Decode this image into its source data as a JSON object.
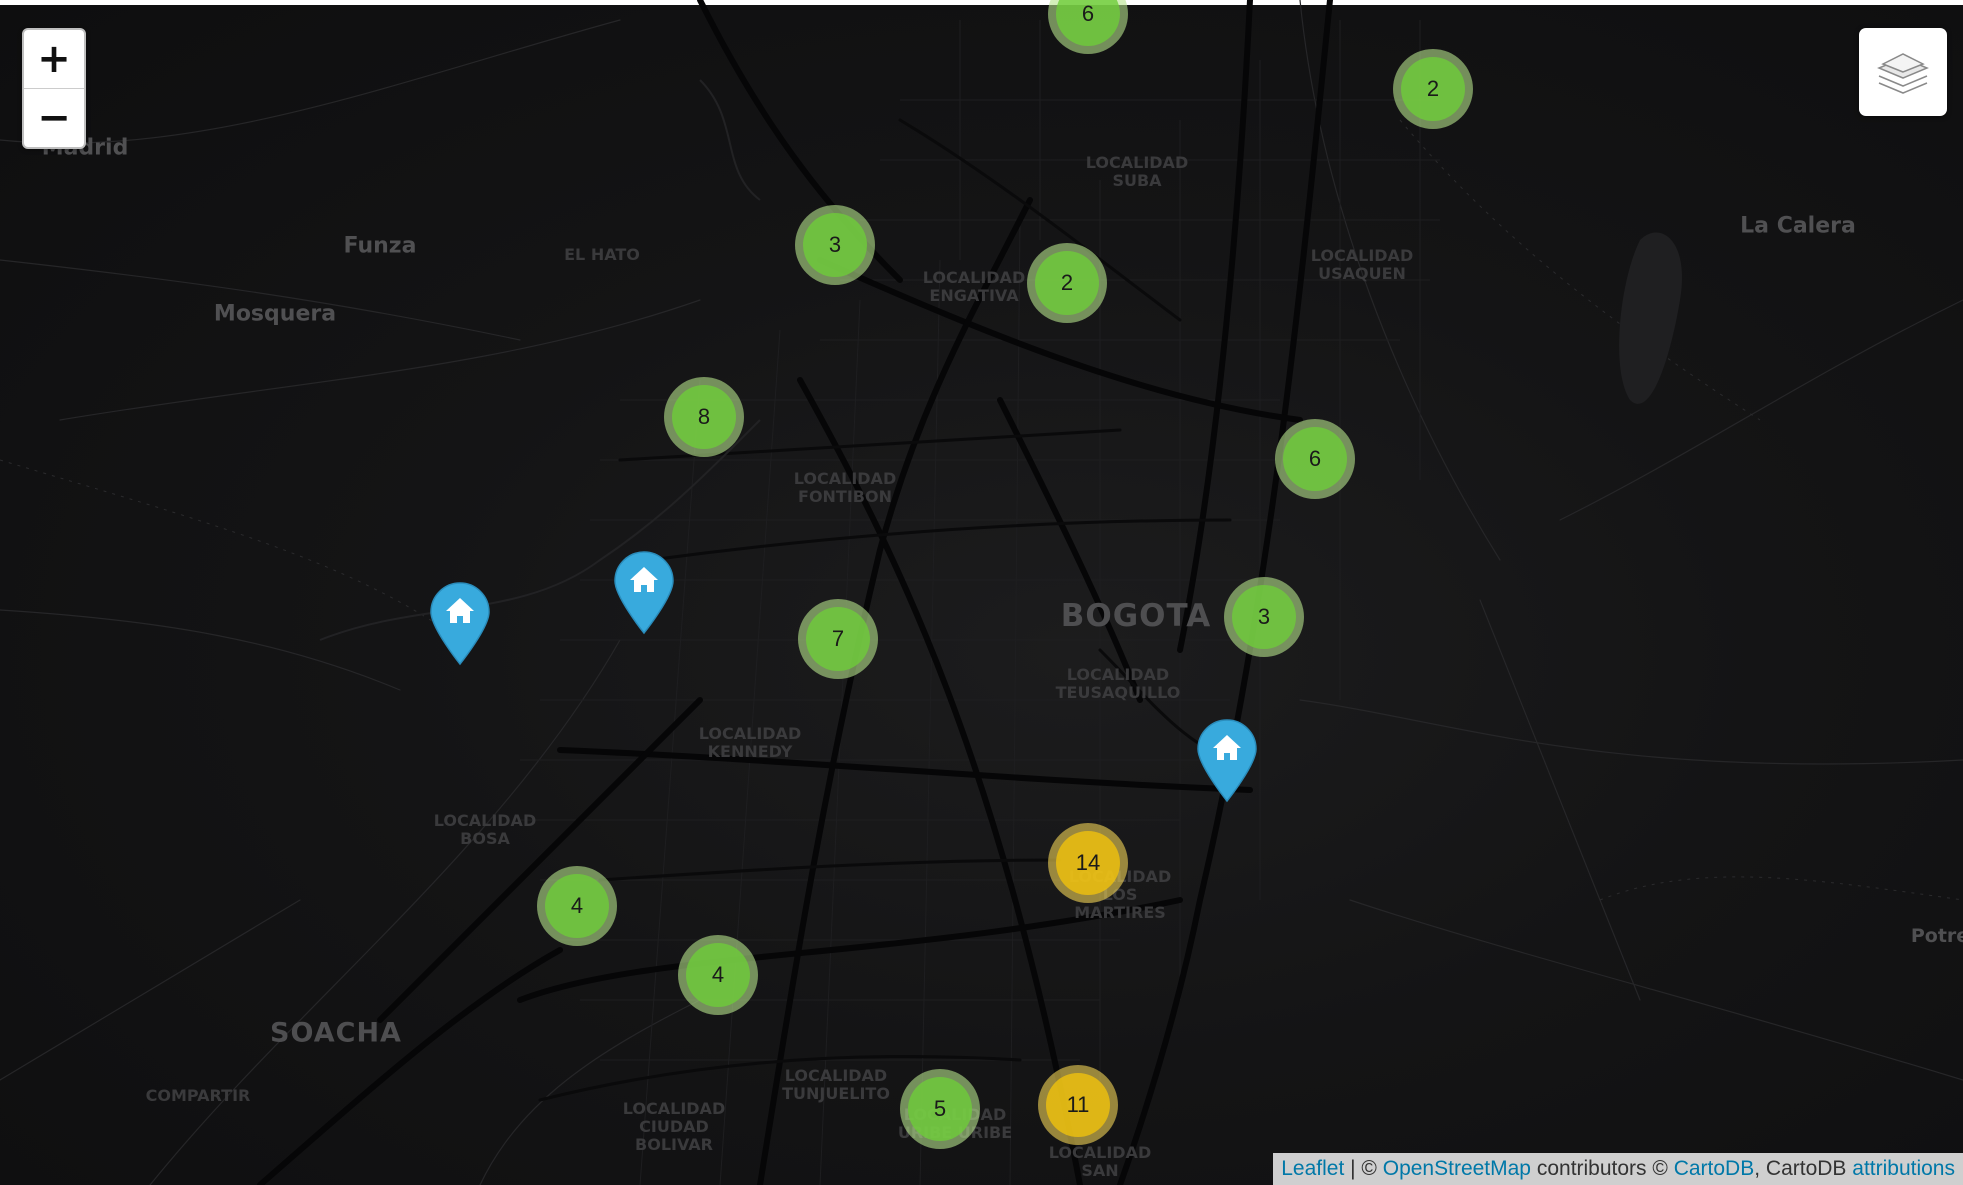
{
  "map": {
    "tile_theme": "dark",
    "background_color": "#141415"
  },
  "controls": {
    "zoom_in_label": "+",
    "zoom_out_label": "−",
    "layers_icon": "layers-icon"
  },
  "place_labels": {
    "madrid": "Madrid",
    "funza": "Funza",
    "mosquera": "Mosquera",
    "el_hato": "EL HATO",
    "la_calera": "La Calera",
    "bogota": "BOGOTA",
    "soacha": "SOACHA",
    "compartir": "COMPARTIR",
    "potre": "Potre",
    "suba": "LOCALIDAD\nSUBA",
    "usaquen": "LOCALIDAD\nUSAQUEN",
    "engativa": "LOCALIDAD\nENGATIVA",
    "fontibon": "LOCALIDAD\nFONTIBON",
    "teusaquillo": "LOCALIDAD\nTEUSAQUILLO",
    "kennedy": "LOCALIDAD\nKENNEDY",
    "bosa": "LOCALIDAD\nBOSA",
    "martires": "LOCALIDAD\nLOS\nMARTIRES",
    "tunjuelito": "LOCALIDAD\nTUNJUELITO",
    "ciudad_bolivar": "LOCALIDAD\nCIUDAD\nBOLIVAR",
    "uribe": "LOCALIDAD\nURIBE URIBE",
    "san": "LOCALIDAD\nSAN"
  },
  "clusters": [
    {
      "count": "6",
      "size": "small"
    },
    {
      "count": "2",
      "size": "small"
    },
    {
      "count": "3",
      "size": "small"
    },
    {
      "count": "2",
      "size": "small"
    },
    {
      "count": "8",
      "size": "small"
    },
    {
      "count": "6",
      "size": "small"
    },
    {
      "count": "3",
      "size": "small"
    },
    {
      "count": "7",
      "size": "small"
    },
    {
      "count": "14",
      "size": "medium"
    },
    {
      "count": "4",
      "size": "small"
    },
    {
      "count": "4",
      "size": "small"
    },
    {
      "count": "5",
      "size": "small"
    },
    {
      "count": "11",
      "size": "medium"
    }
  ],
  "markers": [
    {
      "icon": "home-icon",
      "color": "#38aadd"
    },
    {
      "icon": "home-icon",
      "color": "#38aadd"
    },
    {
      "icon": "home-icon",
      "color": "#38aadd"
    }
  ],
  "attribution": {
    "leaflet": "Leaflet",
    "sep1": " | © ",
    "osm": "OpenStreetMap",
    "sep2": " contributors © ",
    "cartodb": "CartoDB",
    "sep3": ", CartoDB ",
    "attributions": "attributions"
  }
}
